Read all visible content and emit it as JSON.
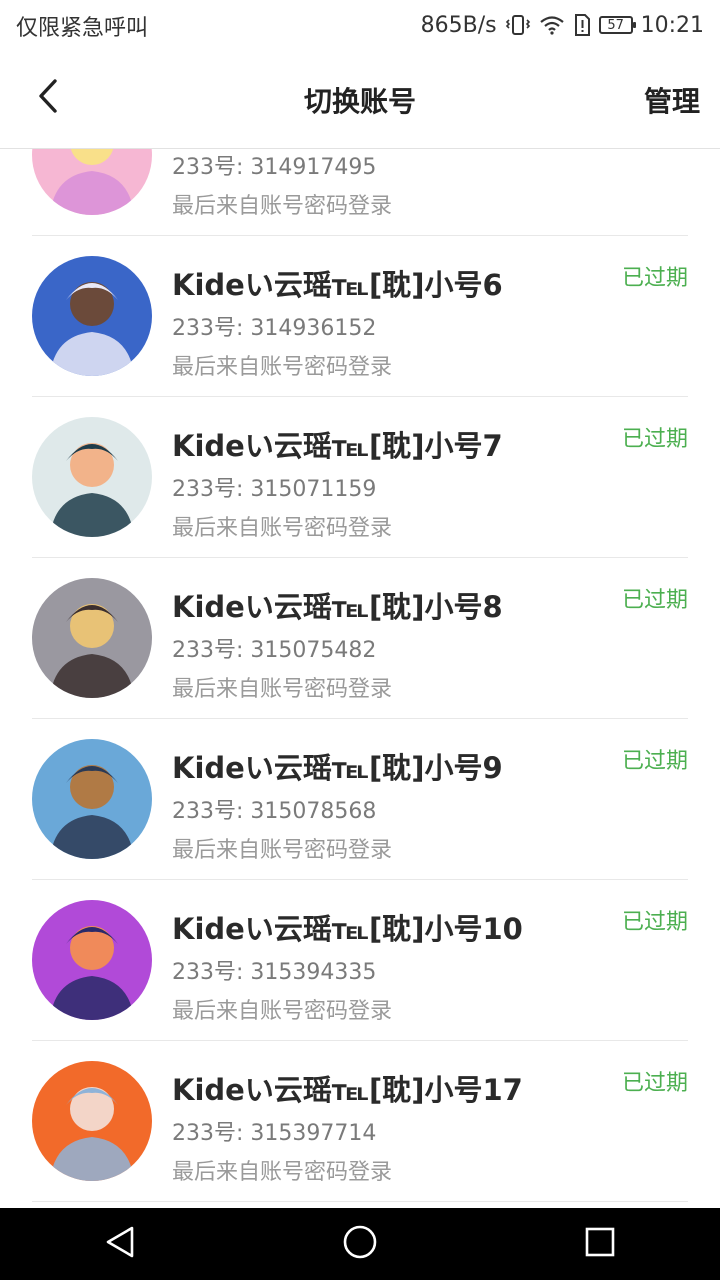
{
  "status_bar": {
    "left_text": "仅限紧急呼叫",
    "net_speed": "865B/s",
    "battery": "57",
    "time": "10:21",
    "icons": [
      "vibrate-icon",
      "wifi-icon",
      "sim-alert-icon",
      "battery-icon"
    ]
  },
  "header": {
    "title": "切换账号",
    "manage_label": "管理",
    "back_icon": "chevron-left-icon"
  },
  "accounts": [
    {
      "name": "",
      "uid": "233号: 314917495",
      "last_login": "最后来自账号密码登录",
      "status": "",
      "avatar_colors": [
        "#f6b7d3",
        "#d88fd8",
        "#f9e08a"
      ]
    },
    {
      "name": "Kideい云瑶℡[耽]小号6",
      "uid": "233号: 314936152",
      "last_login": "最后来自账号密码登录",
      "status": "已过期",
      "avatar_colors": [
        "#3a66c8",
        "#e9e9f7",
        "#6b4a3a"
      ]
    },
    {
      "name": "Kideい云瑶℡[耽]小号7",
      "uid": "233号: 315071159",
      "last_login": "最后来自账号密码登录",
      "status": "已过期",
      "avatar_colors": [
        "#dfe9ea",
        "#1f3c4a",
        "#f2b38a"
      ]
    },
    {
      "name": "Kideい云瑶℡[耽]小号8",
      "uid": "233号: 315075482",
      "last_login": "最后来自账号密码登录",
      "status": "已过期",
      "avatar_colors": [
        "#9a98a0",
        "#3b2f2f",
        "#e8c276"
      ]
    },
    {
      "name": "Kideい云瑶℡[耽]小号9",
      "uid": "233号: 315078568",
      "last_login": "最后来自账号密码登录",
      "status": "已过期",
      "avatar_colors": [
        "#6aa8d8",
        "#2b3a55",
        "#b07a45"
      ]
    },
    {
      "name": "Kideい云瑶℡[耽]小号10",
      "uid": "233号: 315394335",
      "last_login": "最后来自账号密码登录",
      "status": "已过期",
      "avatar_colors": [
        "#b14ad8",
        "#2a2a6a",
        "#f08a5a"
      ]
    },
    {
      "name": "Kideい云瑶℡[耽]小号17",
      "uid": "233号: 315397714",
      "last_login": "最后来自账号密码登录",
      "status": "已过期",
      "avatar_colors": [
        "#f26a2a",
        "#8fb3d8",
        "#f3d5c8"
      ]
    }
  ],
  "nav_bar": {
    "buttons": [
      "back-triangle-icon",
      "home-circle-icon",
      "recents-square-icon"
    ]
  },
  "colors": {
    "status_expired": "#4caf50",
    "divider": "#e8e8e8"
  }
}
